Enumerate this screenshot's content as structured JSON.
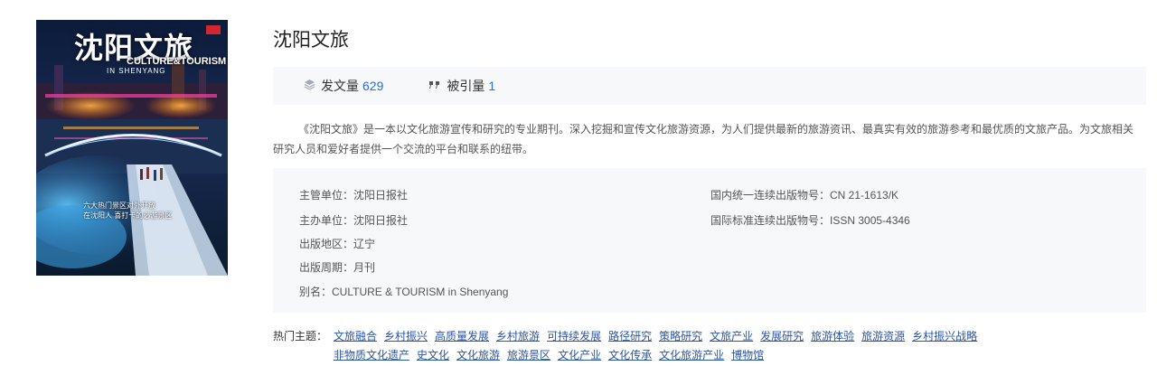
{
  "cover": {
    "title": "沈阳文旅",
    "subtitle": "CULTURE&TOURISM",
    "subtitle2": "IN SHENYANG",
    "caption_line1": "六大热门景区对外开放",
    "caption_line2": "在沈阳人 喜打卡的必游景区"
  },
  "journal": {
    "title": "沈阳文旅"
  },
  "stats": {
    "articles_label": "发文量",
    "articles_value": "629",
    "citations_label": "被引量",
    "citations_value": "1"
  },
  "description": "《沈阳文旅》是一本以文化旅游宣传和研究的专业期刊。深入挖掘和宣传文化旅游资源，为人们提供最新的旅游资讯、最真实有效的旅游参考和最优质的文旅产品。为文旅相关研究人员和爱好者提供一个交流的平台和联系的纽带。",
  "info": {
    "supervisor": "主管单位：沈阳日报社",
    "sponsor": "主办单位：沈阳日报社",
    "region": "出版地区：辽宁",
    "cycle": "出版周期：月刊",
    "alias": "别名：CULTURE & TOURISM in Shenyang",
    "cn": "国内统一连续出版物号：CN 21-1613/K",
    "issn": "国际标准连续出版物号：ISSN 3005-4346"
  },
  "hot_topics": {
    "label": "热门主题：",
    "items": [
      "文旅融合",
      "乡村振兴",
      "高质量发展",
      "乡村旅游",
      "可持续发展",
      "路径研究",
      "策略研究",
      "文旅产业",
      "发展研究",
      "旅游体验",
      "旅游资源",
      "乡村振兴战略",
      "非物质文化遗产",
      "史文化",
      "文化旅游",
      "旅游景区",
      "文化产业",
      "文化传承",
      "文化旅游产业",
      "博物馆"
    ]
  }
}
